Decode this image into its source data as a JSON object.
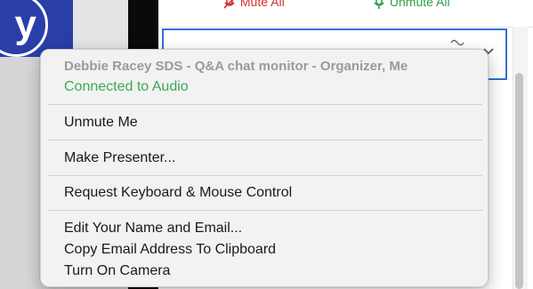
{
  "toolbar": {
    "mute_all_label": "Mute All",
    "unmute_all_label": "Unmute All",
    "mute_color": "#d32f2f",
    "unmute_color": "#2e9e4a"
  },
  "video": {
    "avatar_letter": "y"
  },
  "participant_row": {
    "audio_icon": "audio-wave-icon",
    "chevron_icon": "chevron-down-icon"
  },
  "context_menu": {
    "participant_name": "Debbie Racey SDS - Q&A chat monitor - Organizer, Me",
    "audio_status": "Connected to Audio",
    "status_color": "#3aaa5a",
    "groups": [
      {
        "items": [
          {
            "label": "Unmute Me"
          }
        ]
      },
      {
        "items": [
          {
            "label": "Make Presenter..."
          }
        ]
      },
      {
        "items": [
          {
            "label": "Request Keyboard & Mouse Control"
          }
        ]
      },
      {
        "items": [
          {
            "label": "Edit Your Name and Email..."
          },
          {
            "label": "Copy Email Address To Clipboard"
          },
          {
            "label": "Turn On Camera"
          }
        ]
      }
    ]
  }
}
